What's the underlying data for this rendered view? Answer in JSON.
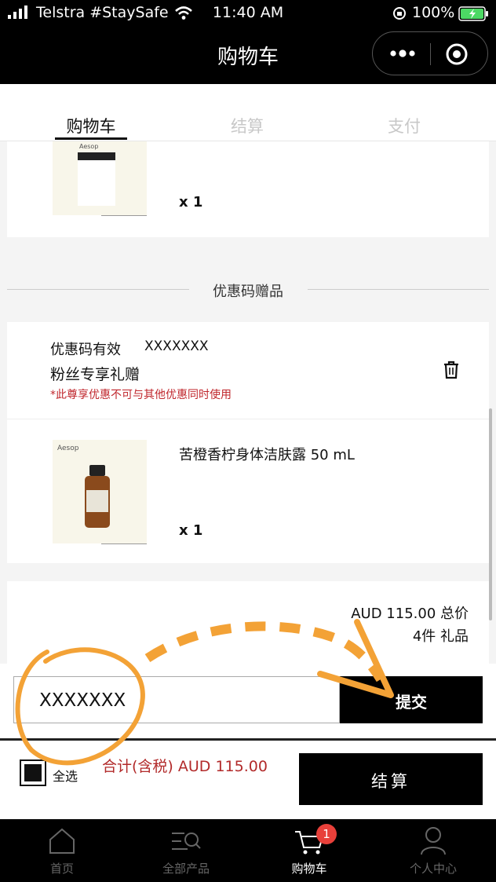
{
  "status_bar": {
    "carrier": "Telstra #StaySafe",
    "time": "11:40 AM",
    "battery": "100%"
  },
  "header": {
    "title": "购物车"
  },
  "tabs": [
    {
      "label": "购物车",
      "active": true
    },
    {
      "label": "结算",
      "active": false
    },
    {
      "label": "支付",
      "active": false
    }
  ],
  "items": [
    {
      "brand": "Aesop",
      "name": "",
      "quantity": "x 1"
    }
  ],
  "promo_section": {
    "heading": "优惠码赠品",
    "valid_label": "优惠码有效",
    "code": "XXXXXXX",
    "gift_title": "粉丝专享礼赠",
    "notice": "*此尊享优惠不可与其他优惠同时使用",
    "gift_item": {
      "brand": "Aesop",
      "name": "苦橙香柠身体洁肤露 50 mL",
      "quantity": "x 1"
    }
  },
  "summary": {
    "total": "AUD 115.00 总价",
    "count": "4件 礼品"
  },
  "promo_input": {
    "value": "XXXXXXX",
    "submit_label": "提交"
  },
  "footer": {
    "select_all_label": "全选",
    "subtotal": "合计(含税) AUD 115.00",
    "checkout_label": "结算"
  },
  "tab_bar": [
    {
      "label": "首页",
      "icon": "home-icon"
    },
    {
      "label": "全部产品",
      "icon": "product-search-icon"
    },
    {
      "label": "购物车",
      "icon": "cart-icon",
      "badge": "1",
      "active": true
    },
    {
      "label": "个人中心",
      "icon": "profile-icon"
    }
  ],
  "colors": {
    "accent_red": "#c0272d",
    "annotation_orange": "#f3a236",
    "bar_black": "#000000"
  }
}
